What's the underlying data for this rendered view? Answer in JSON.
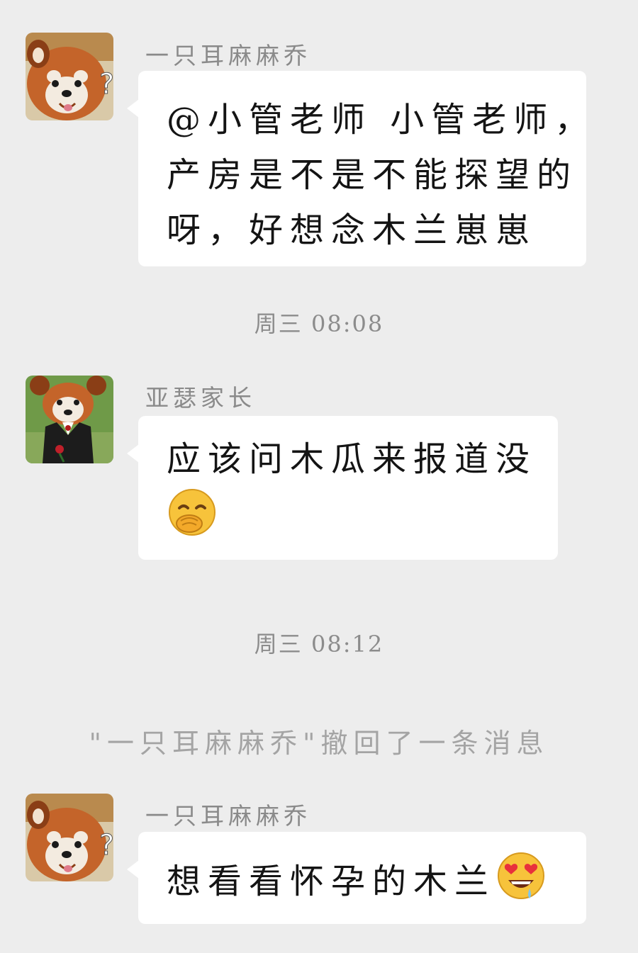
{
  "messages": [
    {
      "sender": "一只耳麻麻乔",
      "lines": [
        "@小管老师  小管老师，",
        "产房是不是不能探望的",
        "呀，好想念木兰崽崽"
      ]
    },
    {
      "sender": "亚瑟家长",
      "lines": [
        "应该问木瓜来报道没"
      ],
      "emoji": "face-with-hand-over-mouth-emoji"
    },
    {
      "sender": "一只耳麻麻乔",
      "lines": [
        "想看看怀孕的木兰"
      ],
      "emoji": "heart-eyes-drooling-emoji"
    }
  ],
  "timestamps": [
    "周三 08:08",
    "周三 08:12"
  ],
  "system_notice": "\"一只耳麻麻乔\"撤回了一条消息",
  "colors": {
    "background": "#ededed",
    "bubble": "#ffffff",
    "sender_text": "#8a8a8a",
    "timestamp_text": "#8c8c8c",
    "notice_text": "#a4a4a4",
    "red_panda_fur": "#c4642a"
  }
}
